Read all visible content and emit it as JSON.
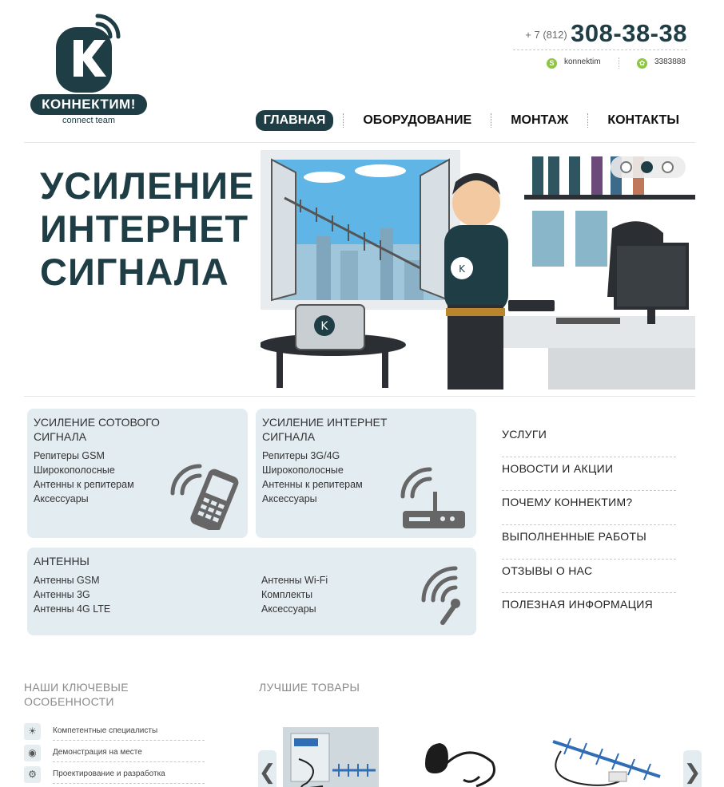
{
  "brand": {
    "name": "КОННЕКТИМ!",
    "tagline": "connect team"
  },
  "contacts": {
    "phone_prefix": "+ 7 (812)",
    "phone_number": "308-38-38",
    "skype": "konnektim",
    "icq": "3383888"
  },
  "nav": {
    "items": [
      {
        "label": "ГЛАВНАЯ",
        "active": true
      },
      {
        "label": "ОБОРУДОВАНИЕ",
        "active": false
      },
      {
        "label": "МОНТАЖ",
        "active": false
      },
      {
        "label": "КОНТАКТЫ",
        "active": false
      }
    ]
  },
  "banner": {
    "title_lines": [
      "УСИЛЕНИЕ",
      "ИНТЕРНЕТ",
      "СИГНАЛА"
    ],
    "logo_text": "КОННЕКТИМ!",
    "slide_count": 3,
    "active_slide": 2
  },
  "categories": {
    "cellular": {
      "title": "УСИЛЕНИЕ СОТОВОГО\nСИГНАЛА",
      "links": [
        "Репитеры GSM",
        "Широкополосные",
        "Антенны к репитерам",
        "Аксессуары"
      ]
    },
    "internet": {
      "title": "УСИЛЕНИЕ ИНТЕРНЕТ\nСИГНАЛА",
      "links": [
        "Репитеры 3G/4G",
        "Широкополосные",
        "Антенны к репитерам",
        "Аксессуары"
      ]
    },
    "antennas": {
      "title": "АНТЕННЫ",
      "links_left": [
        "Антенны GSM",
        "Антенны 3G",
        "Антенны 4G LTE"
      ],
      "links_right": [
        "Антенны Wi-Fi",
        "Комплекты",
        "Аксессуары"
      ]
    }
  },
  "side_menu": {
    "items": [
      "УСЛУГИ",
      "НОВОСТИ И АКЦИИ",
      "ПОЧЕМУ КОННЕКТИМ?",
      "ВЫПОЛНЕННЫЕ РАБОТЫ",
      "ОТЗЫВЫ О НАС",
      "ПОЛЕЗНАЯ ИНФОРМАЦИЯ"
    ]
  },
  "features": {
    "heading": "НАШИ КЛЮЧЕВЫЕ\nОСОБЕННОСТИ",
    "items": [
      {
        "label": "Компетентные специалисты",
        "icon": "lightbulb-icon"
      },
      {
        "label": "Демонстрация на месте",
        "icon": "eye-icon"
      },
      {
        "label": "Проектирование и разработка",
        "icon": "gear-icon"
      }
    ]
  },
  "products": {
    "heading": "ЛУЧШИЕ ТОВАРЫ",
    "prev": "❮",
    "next": "❯"
  },
  "colors": {
    "brand_dark": "#1f3d44",
    "card_bg": "#e3ecf1",
    "accent_green": "#8dc63f"
  }
}
